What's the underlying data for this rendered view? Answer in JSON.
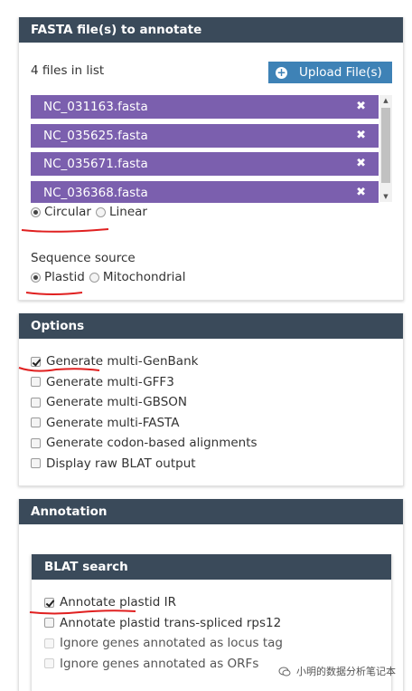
{
  "fasta_panel": {
    "title": "FASTA file(s) to annotate",
    "files_count": "4 files in list",
    "upload_button": "Upload File(s)",
    "files": [
      "NC_031163.fasta",
      "NC_035625.fasta",
      "NC_035671.fasta",
      "NC_036368.fasta"
    ],
    "topology": {
      "options": [
        "Circular",
        "Linear"
      ],
      "selected": "Circular"
    },
    "sequence_source": {
      "label": "Sequence source",
      "options": [
        "Plastid",
        "Mitochondrial"
      ],
      "selected": "Plastid"
    }
  },
  "options_panel": {
    "title": "Options",
    "items": [
      {
        "label": "Generate multi-GenBank",
        "checked": true
      },
      {
        "label": "Generate multi-GFF3",
        "checked": false
      },
      {
        "label": "Generate multi-GBSON",
        "checked": false
      },
      {
        "label": "Generate multi-FASTA",
        "checked": false
      },
      {
        "label": "Generate codon-based alignments",
        "checked": false
      },
      {
        "label": "Display raw BLAT output",
        "checked": false
      }
    ]
  },
  "annotation_panel": {
    "title": "Annotation",
    "blat": {
      "title": "BLAT search",
      "items": [
        {
          "label": "Annotate plastid IR",
          "checked": true
        },
        {
          "label": "Annotate plastid trans-spliced rps12",
          "checked": false
        },
        {
          "label": "Ignore genes annotated as locus tag",
          "checked": false,
          "disabled": true
        },
        {
          "label": "Ignore genes annotated as ORFs",
          "checked": false,
          "disabled": true
        }
      ]
    }
  },
  "watermark": {
    "text": "小明的数据分析笔记本"
  },
  "colors": {
    "header": "#3a4a5a",
    "file_item": "#7b5fae",
    "upload_button": "#3e82b6",
    "annotation_line": "#e02020"
  }
}
